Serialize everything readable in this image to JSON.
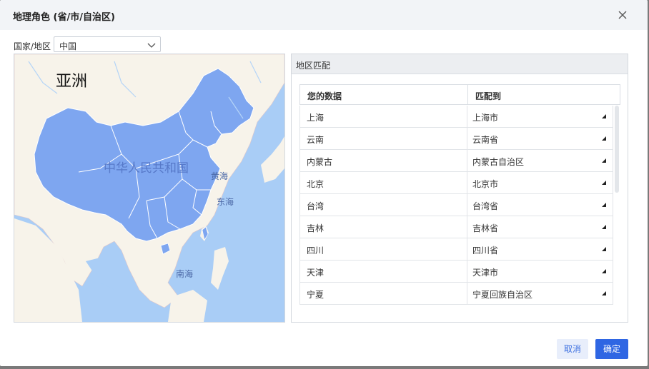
{
  "dialog": {
    "title": "地理角色 (省/市/自治区)",
    "country_label": "国家/地区",
    "country_value": "中国"
  },
  "map": {
    "labels": {
      "continent": "亚洲",
      "country": "中华人民共和国",
      "yellow_sea": "黄海",
      "east_sea": "东海",
      "south_sea": "南海"
    }
  },
  "panel": {
    "title": "地区匹配",
    "col_data": "您的数据",
    "col_match": "匹配到",
    "rows": [
      {
        "data": "上海",
        "match": "上海市"
      },
      {
        "data": "云南",
        "match": "云南省"
      },
      {
        "data": "内蒙古",
        "match": "内蒙古自治区"
      },
      {
        "data": "北京",
        "match": "北京市"
      },
      {
        "data": "台湾",
        "match": "台湾省"
      },
      {
        "data": "吉林",
        "match": "吉林省"
      },
      {
        "data": "四川",
        "match": "四川省"
      },
      {
        "data": "天津",
        "match": "天津市"
      },
      {
        "data": "宁夏",
        "match": "宁夏回族自治区"
      }
    ]
  },
  "buttons": {
    "cancel": "取消",
    "ok": "确定"
  },
  "colors": {
    "accent": "#2f66e3",
    "region_fill": "#7ea6f0",
    "sea": "#a9cdf6",
    "land": "#f7f3ea"
  }
}
